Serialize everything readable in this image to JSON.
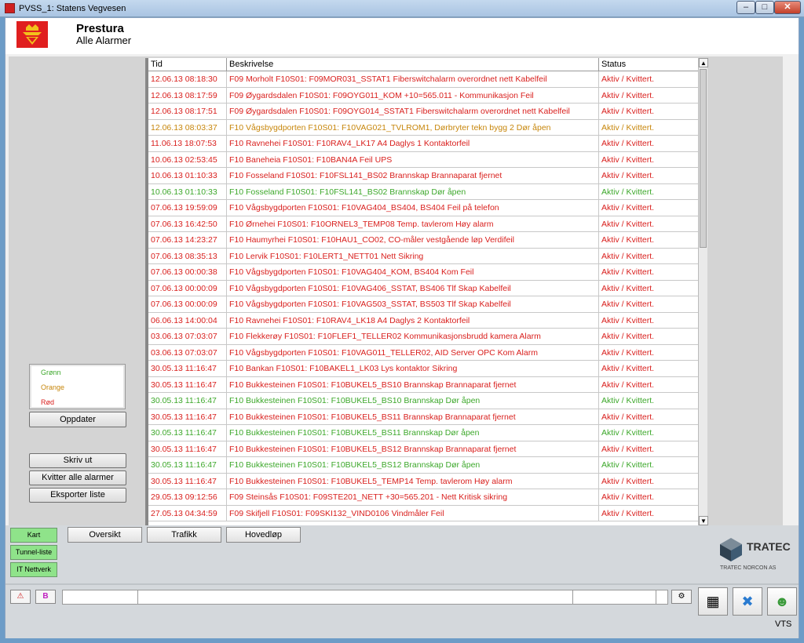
{
  "window": {
    "title": "PVSS_1: Statens Vegvesen",
    "min": "–",
    "max": "□",
    "close": "✕"
  },
  "header": {
    "title": "Prestura",
    "subtitle": "Alle Alarmer"
  },
  "columns": [
    "Tid",
    "Beskrivelse",
    "Status"
  ],
  "alarms": [
    {
      "tid": "12.06.13  08:18:30",
      "desc": "F09 Morholt F10S01: F09MOR031_SSTAT1 Fiberswitchalarm overordnet nett Kabelfeil",
      "status": "Aktiv / Kvittert.",
      "color": "red"
    },
    {
      "tid": "12.06.13  08:17:59",
      "desc": "F09 Øygardsdalen F10S01: F09OYG011_KOM +10=565.011 - Kommunikasjon Feil",
      "status": "Aktiv / Kvittert.",
      "color": "red"
    },
    {
      "tid": "12.06.13  08:17:51",
      "desc": "F09 Øygardsdalen F10S01: F09OYG014_SSTAT1 Fiberswitchalarm overordnet nett Kabelfeil",
      "status": "Aktiv / Kvittert.",
      "color": "red"
    },
    {
      "tid": "12.06.13  08:03:37",
      "desc": "F10 Vågsbygdporten F10S01: F10VAG021_TVLROM1, Dørbryter tekn bygg 2 Dør åpen",
      "status": "Aktiv / Kvittert.",
      "color": "orange"
    },
    {
      "tid": "11.06.13  18:07:53",
      "desc": "F10 Ravnehei F10S01: F10RAV4_LK17 A4 Daglys 1 Kontaktorfeil",
      "status": "Aktiv / Kvittert.",
      "color": "red"
    },
    {
      "tid": "10.06.13  02:53:45",
      "desc": "F10 Baneheia F10S01: F10BAN4A Feil UPS",
      "status": "Aktiv / Kvittert.",
      "color": "red"
    },
    {
      "tid": "10.06.13  01:10:33",
      "desc": "F10 Fosseland F10S01: F10FSL141_BS02 Brannskap Brannaparat fjernet",
      "status": "Aktiv / Kvittert.",
      "color": "red"
    },
    {
      "tid": "10.06.13  01:10:33",
      "desc": "F10 Fosseland F10S01: F10FSL141_BS02 Brannskap Dør åpen",
      "status": "Aktiv / Kvittert.",
      "color": "green"
    },
    {
      "tid": "07.06.13  19:59:09",
      "desc": "F10 Vågsbygdporten F10S01: F10VAG404_BS404, BS404 Feil på telefon",
      "status": "Aktiv / Kvittert.",
      "color": "red"
    },
    {
      "tid": "07.06.13  16:42:50",
      "desc": "F10 Ørnehei F10S01: F10ORNEL3_TEMP08 Temp. tavlerom Høy alarm",
      "status": "Aktiv / Kvittert.",
      "color": "red"
    },
    {
      "tid": "07.06.13  14:23:27",
      "desc": "F10 Haumyrhei F10S01: F10HAU1_CO02, CO-måler vestgående løp Verdifeil",
      "status": "Aktiv / Kvittert.",
      "color": "red"
    },
    {
      "tid": "07.06.13  08:35:13",
      "desc": "F10 Lervik F10S01: F10LERT1_NETT01 Nett Sikring",
      "status": "Aktiv / Kvittert.",
      "color": "red"
    },
    {
      "tid": "07.06.13  00:00:38",
      "desc": "F10 Vågsbygdporten F10S01: F10VAG404_KOM, BS404 Kom Feil",
      "status": "Aktiv / Kvittert.",
      "color": "red"
    },
    {
      "tid": "07.06.13  00:00:09",
      "desc": "F10 Vågsbygdporten F10S01: F10VAG406_SSTAT, BS406  Tlf Skap Kabelfeil",
      "status": "Aktiv / Kvittert.",
      "color": "red"
    },
    {
      "tid": "07.06.13  00:00:09",
      "desc": "F10 Vågsbygdporten F10S01: F10VAG503_SSTAT, BS503  Tlf Skap Kabelfeil",
      "status": "Aktiv / Kvittert.",
      "color": "red"
    },
    {
      "tid": "06.06.13  14:00:04",
      "desc": "F10 Ravnehei F10S01: F10RAV4_LK18 A4 Daglys 2 Kontaktorfeil",
      "status": "Aktiv / Kvittert.",
      "color": "red"
    },
    {
      "tid": "03.06.13  07:03:07",
      "desc": "F10 Flekkerøy F10S01: F10FLEF1_TELLER02 Kommunikasjonsbrudd kamera Alarm",
      "status": "Aktiv / Kvittert.",
      "color": "red"
    },
    {
      "tid": "03.06.13  07:03:07",
      "desc": "F10 Vågsbygdporten F10S01: F10VAG011_TELLER02, AID Server OPC Kom Alarm",
      "status": "Aktiv / Kvittert.",
      "color": "red"
    },
    {
      "tid": "30.05.13  11:16:47",
      "desc": "F10 Bankan F10S01: F10BAKEL1_LK03 Lys kontaktor Sikring",
      "status": "Aktiv / Kvittert.",
      "color": "red"
    },
    {
      "tid": "30.05.13  11:16:47",
      "desc": "F10 Bukkesteinen F10S01: F10BUKEL5_BS10 Brannskap Brannaparat fjernet",
      "status": "Aktiv / Kvittert.",
      "color": "red"
    },
    {
      "tid": "30.05.13  11:16:47",
      "desc": "F10 Bukkesteinen F10S01: F10BUKEL5_BS10 Brannskap Dør åpen",
      "status": "Aktiv / Kvittert.",
      "color": "green"
    },
    {
      "tid": "30.05.13  11:16:47",
      "desc": "F10 Bukkesteinen F10S01: F10BUKEL5_BS11 Brannskap Brannaparat fjernet",
      "status": "Aktiv / Kvittert.",
      "color": "red"
    },
    {
      "tid": "30.05.13  11:16:47",
      "desc": "F10 Bukkesteinen F10S01: F10BUKEL5_BS11 Brannskap Dør åpen",
      "status": "Aktiv / Kvittert.",
      "color": "green"
    },
    {
      "tid": "30.05.13  11:16:47",
      "desc": "F10 Bukkesteinen F10S01: F10BUKEL5_BS12 Brannskap Brannaparat fjernet",
      "status": "Aktiv / Kvittert.",
      "color": "red"
    },
    {
      "tid": "30.05.13  11:16:47",
      "desc": "F10 Bukkesteinen F10S01: F10BUKEL5_BS12 Brannskap Dør åpen",
      "status": "Aktiv / Kvittert.",
      "color": "green"
    },
    {
      "tid": "30.05.13  11:16:47",
      "desc": "F10 Bukkesteinen F10S01: F10BUKEL5_TEMP14 Temp. tavlerom Høy alarm",
      "status": "Aktiv / Kvittert.",
      "color": "red"
    },
    {
      "tid": "29.05.13  09:12:56",
      "desc": "F09 Steinsås F10S01: F09STE201_NETT +30=565.201 - Nett Kritisk sikring",
      "status": "Aktiv / Kvittert.",
      "color": "red"
    },
    {
      "tid": "27.05.13  04:34:59",
      "desc": "F09 Skifjell F10S01: F09SKI132_VIND0106 Vindmåler Feil",
      "status": "Aktiv / Kvittert.",
      "color": "red"
    }
  ],
  "legend": [
    {
      "label": "Grønn",
      "color": "#3da82b"
    },
    {
      "label": "Orange",
      "color": "#c7860b"
    },
    {
      "label": "Rød",
      "color": "#d9201e"
    }
  ],
  "buttons": {
    "oppdater": "Oppdater",
    "skriv_ut": "Skriv ut",
    "kvitter": "Kvitter alle alarmer",
    "eksporter": "Eksporter liste"
  },
  "side_buttons": {
    "kart": "Kart",
    "tunnel": "Tunnel-liste",
    "it": "IT Nettverk"
  },
  "nav": {
    "oversikt": "Oversikt",
    "trafikk": "Trafikk",
    "hovedlop": "Hovedløp"
  },
  "brand": {
    "name": "TRATEC",
    "sub": "TRATEC NORCON AS"
  },
  "statusbar": {
    "warning_icon": "⚠",
    "b_icon": "B",
    "vts": "VTS"
  },
  "colors": {
    "red": "#d9201e",
    "green": "#3da82b",
    "orange": "#c7860b"
  }
}
